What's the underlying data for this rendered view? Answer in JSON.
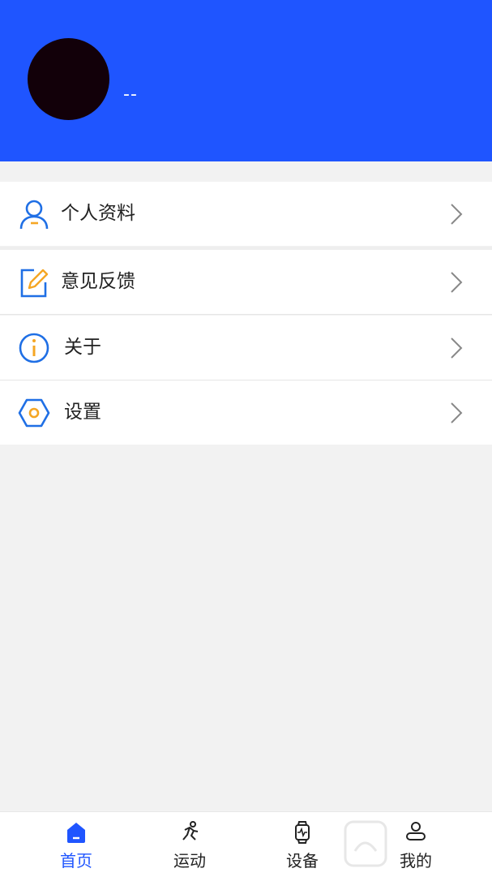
{
  "profile": {
    "nickname": "--"
  },
  "menu": [
    {
      "label": "个人资料",
      "icon": "user-icon"
    },
    {
      "label": "意见反馈",
      "icon": "edit-note-icon"
    },
    {
      "label": "关于",
      "icon": "info-icon"
    },
    {
      "label": "设置",
      "icon": "settings-hexagon-icon"
    }
  ],
  "tabs": [
    {
      "label": "首页",
      "icon": "home-icon",
      "active": true
    },
    {
      "label": "运动",
      "icon": "running-icon",
      "active": false
    },
    {
      "label": "设备",
      "icon": "watch-icon",
      "active": false
    },
    {
      "label": "我的",
      "icon": "person-icon",
      "active": false
    }
  ],
  "colors": {
    "header": "#1f55ff",
    "accent": "#1f55ff",
    "icon_orange": "#f5a623",
    "background": "#f2f2f2"
  }
}
